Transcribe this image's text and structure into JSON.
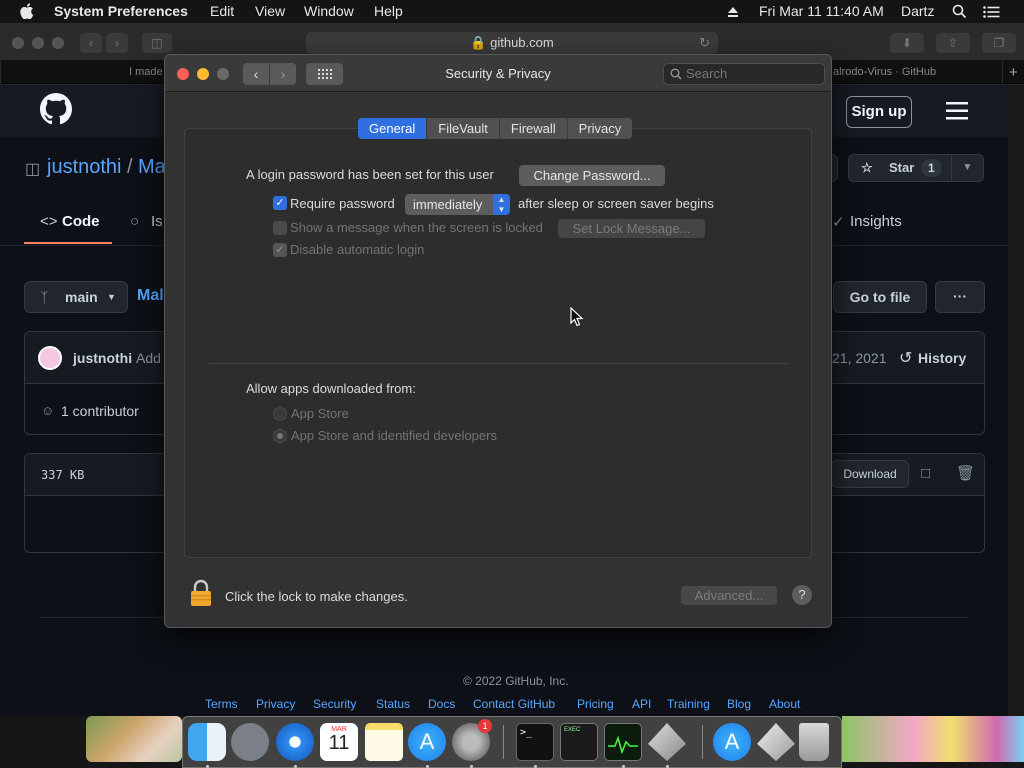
{
  "menubar": {
    "apple": "",
    "app": "System Preferences",
    "items": [
      "Edit",
      "View",
      "Window",
      "Help"
    ],
    "clock": "Fri Mar 11  11:40 AM",
    "user": "Dartz"
  },
  "safari": {
    "url": "github.com",
    "tabs": [
      "I made",
      "alrodo-Virus · GitHub"
    ],
    "new_tab": "+"
  },
  "github": {
    "sign_up": "Sign up",
    "owner": "justnothi",
    "sep": "/",
    "repo": "Ma",
    "star_label": "Star",
    "star_count": "1",
    "tab_code": "Code",
    "tab_issues": "Is",
    "tab_insights": "Insights",
    "branch": "main",
    "path_frag": "Mal",
    "go_to_file": "Go to file",
    "more": "···",
    "commit_author": "justnothi",
    "commit_msg_frag": "Add",
    "commit_date_frag": "21, 2021",
    "history": "History",
    "contributors": "1 contributor",
    "file_size": "337 KB",
    "download": "Download",
    "footer_links": [
      "Terms",
      "Privacy",
      "Security",
      "Status",
      "Docs",
      "Contact GitHub",
      "Pricing",
      "API",
      "Training",
      "Blog",
      "About"
    ],
    "copyright": "© 2022 GitHub, Inc."
  },
  "prefs": {
    "title": "Security & Privacy",
    "search_placeholder": "Search",
    "tabs": [
      "General",
      "FileVault",
      "Firewall",
      "Privacy"
    ],
    "active_tab": "General",
    "login_password_text": "A login password has been set for this user",
    "change_password_button": "Change Password...",
    "require_password_label": "Require password",
    "require_password_checked": true,
    "require_password_value": "immediately",
    "after_sleep_text": "after sleep or screen saver begins",
    "show_message_label": "Show a message when the screen is locked",
    "show_message_checked": false,
    "set_lock_message_button": "Set Lock Message...",
    "disable_auto_login_label": "Disable automatic login",
    "disable_auto_login_checked": true,
    "allow_apps_heading": "Allow apps downloaded from:",
    "radio_app_store": "App Store",
    "radio_identified": "App Store and identified developers",
    "selected_radio": "App Store and identified developers",
    "lock_text": "Click the lock to make changes.",
    "advanced_button": "Advanced...",
    "help_button": "?"
  },
  "dock": {
    "calendar_month": "MAR",
    "calendar_day": "11",
    "prefs_badge": "1",
    "terminal_prompt": ">_",
    "console_label": "EXEC"
  },
  "colors": {
    "accent": "#2f6fe0",
    "github_link": "#58a6ff",
    "close": "#fe5f57",
    "minimize": "#febc2e"
  }
}
